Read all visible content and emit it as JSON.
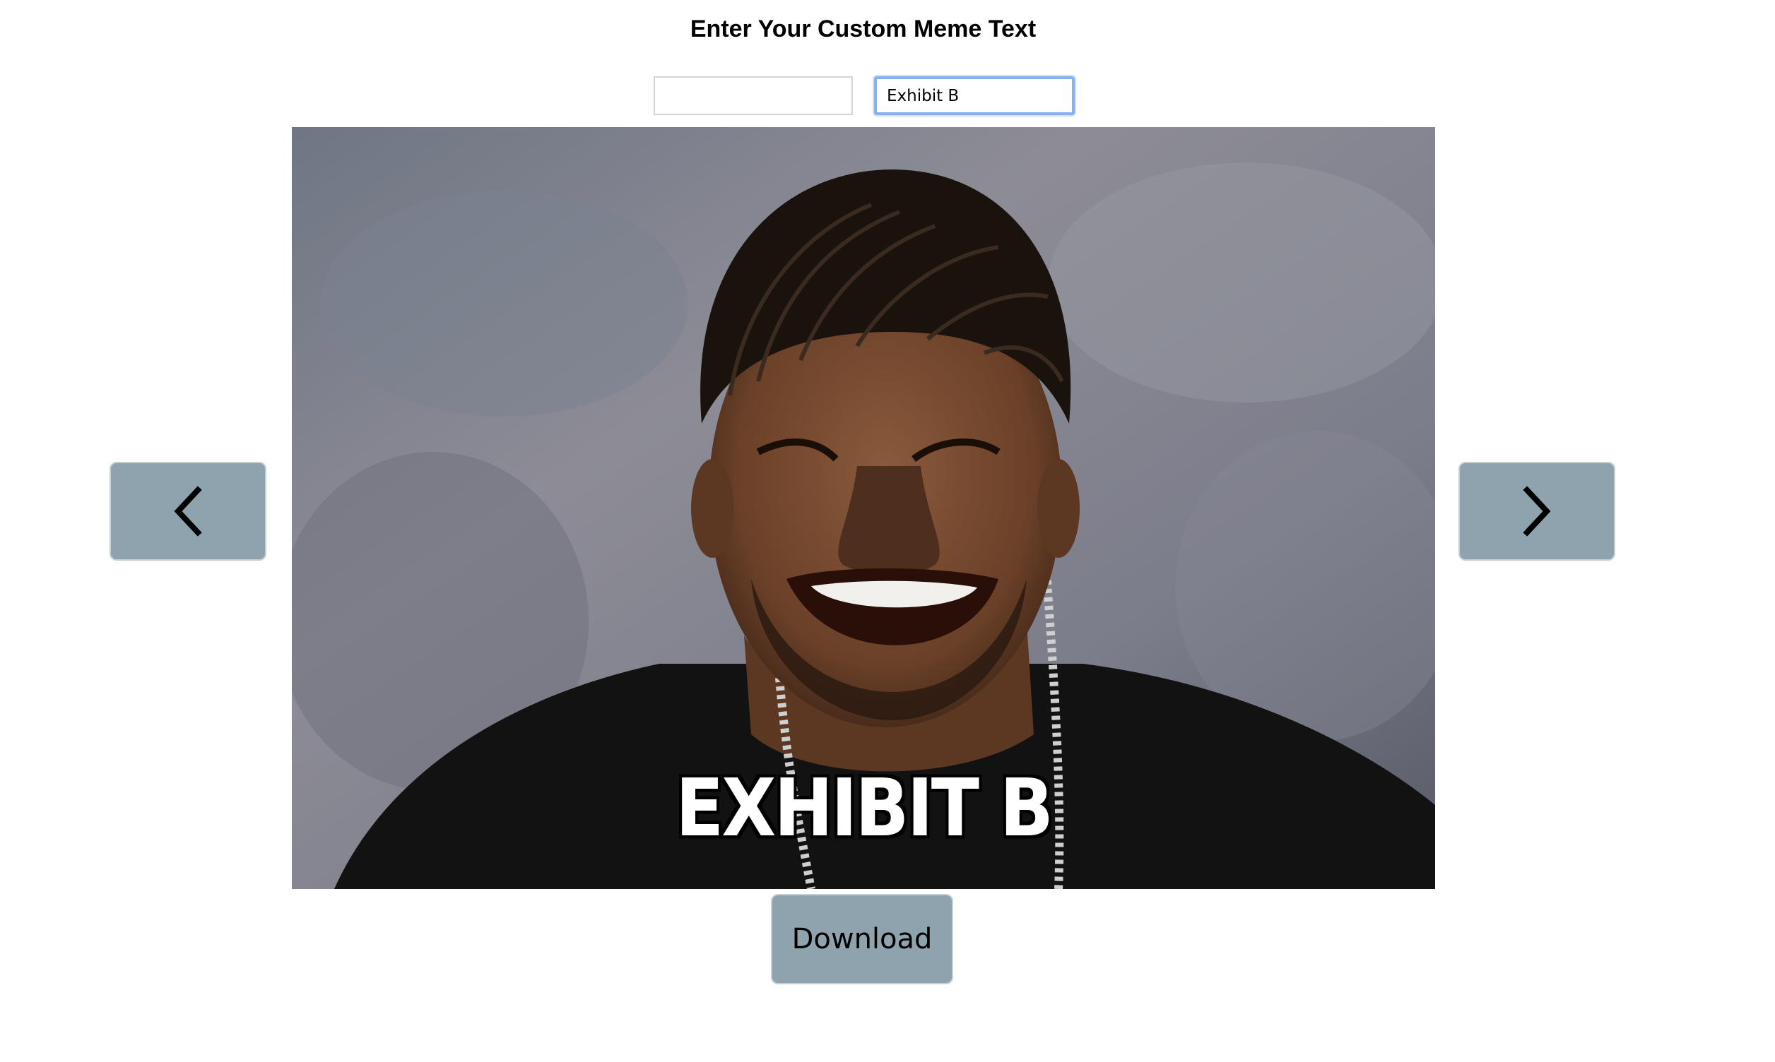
{
  "page": {
    "title": "Enter Your Custom Meme Text"
  },
  "form": {
    "top_text_value": "",
    "bottom_text_value": "Exhibit B"
  },
  "meme": {
    "caption": "EXHIBIT B"
  },
  "nav": {
    "prev_icon": "chevron-left-icon",
    "next_icon": "chevron-right-icon"
  },
  "actions": {
    "download_label": "Download"
  },
  "colors": {
    "button_bg": "#8ea3ad",
    "focus_ring": "#86b2f3"
  }
}
